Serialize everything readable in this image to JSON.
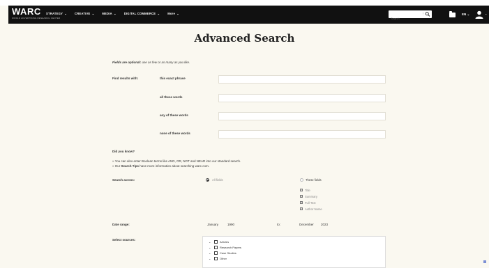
{
  "nav": {
    "logo": "WARC",
    "logo_sub": "WORLD ADVERTISING RESEARCH CENTER",
    "items": [
      {
        "label": "STRATEGY"
      },
      {
        "label": "CREATIVE"
      },
      {
        "label": "MEDIA"
      },
      {
        "label": "DIGITAL COMMERCE"
      },
      {
        "label": "More"
      }
    ],
    "search_placeholder": "Search",
    "lang": "EN"
  },
  "page": {
    "title": "Advanced Search",
    "optional_bold": "Fields are optional:",
    "optional_rest": " use as few or as many as you like."
  },
  "find": {
    "label": "Find results with:",
    "fields": [
      {
        "label": "this exact phrase",
        "value": ""
      },
      {
        "label": "all these words",
        "value": ""
      },
      {
        "label": "any of these words",
        "value": ""
      },
      {
        "label": "none of these words",
        "value": ""
      }
    ]
  },
  "tips": {
    "heading": "Did you know?",
    "line1": "» You can also enter Boolean terms like AND, OR, NOT and NEAR into our standard search.",
    "line2_pre": "» Our ",
    "line2_link": "Search Tips",
    "line2_post": " have more information about searching warc.com."
  },
  "scope": {
    "label": "Search across:",
    "option_all": "All fields",
    "option_these": "These fields",
    "fields": [
      {
        "label": "Title"
      },
      {
        "label": "Summary"
      },
      {
        "label": "Full Text"
      },
      {
        "label": "Author Name"
      }
    ]
  },
  "dates": {
    "label": "Date range:",
    "from_month": "January",
    "from_year": "1990",
    "to_label": "to:",
    "to_month": "December",
    "to_year": "2023"
  },
  "sources": {
    "label": "Select sources:",
    "items": [
      {
        "label": "Articles"
      },
      {
        "label": "Research Papers"
      },
      {
        "label": "Case Studies"
      },
      {
        "label": "Other"
      }
    ]
  }
}
